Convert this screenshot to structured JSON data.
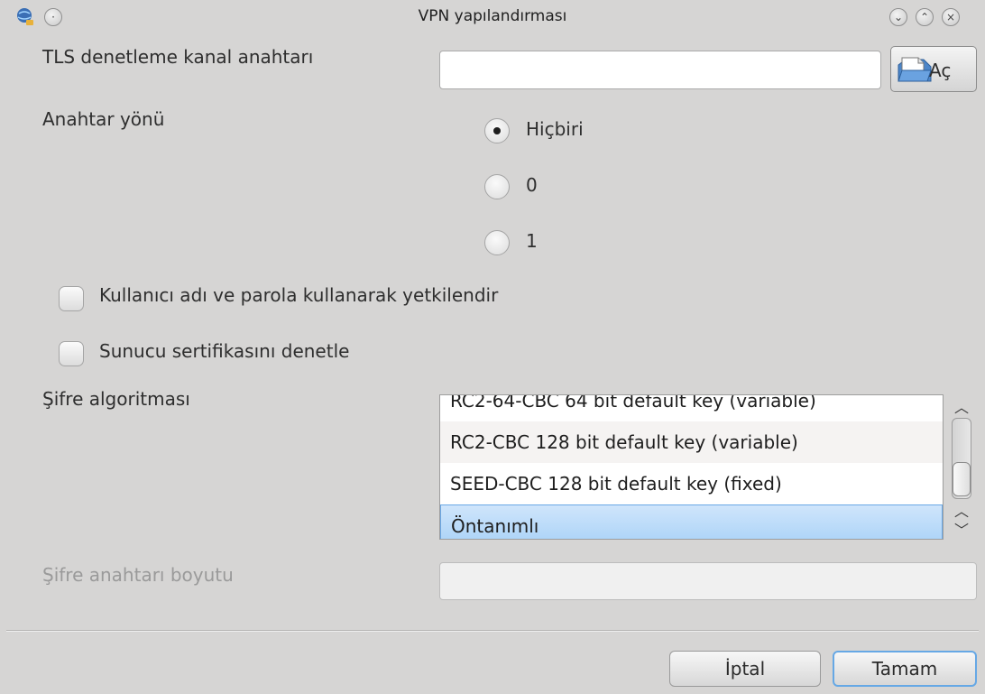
{
  "window": {
    "title": "VPN yapılandırması"
  },
  "tls": {
    "label": "TLS denetleme kanal anahtarı",
    "value": "",
    "open_button": "Aç"
  },
  "key_direction": {
    "label": "Anahtar yönü",
    "options": [
      "Hiçbiri",
      "0",
      "1"
    ],
    "selected": "Hiçbiri"
  },
  "checkboxes": {
    "auth_label": "Kullanıcı adı ve parola kullanarak yetkilendir",
    "auth_checked": false,
    "verify_label": "Sunucu sertifikasını denetle",
    "verify_checked": false
  },
  "cipher": {
    "label": "Şifre algoritması",
    "items": [
      "RC2-64-CBC 64 bit default key (variable)",
      "RC2-CBC 128 bit default key (variable)",
      "SEED-CBC 128 bit default key (fixed)",
      "Öntanımlı"
    ],
    "selected": "Öntanımlı"
  },
  "key_size": {
    "label": "Şifre anahtarı boyutu",
    "value": ""
  },
  "buttons": {
    "cancel": "İptal",
    "ok": "Tamam"
  },
  "colors": {
    "window_bg": "#d6d5d4",
    "selection": "#a9d2f7",
    "default_button_border": "#66a8e5"
  },
  "icons": [
    "network-app-icon",
    "pin-icon",
    "minimize-icon",
    "maximize-icon",
    "close-icon",
    "open-file-icon",
    "scroll-up-icon",
    "scroll-down-icon"
  ]
}
